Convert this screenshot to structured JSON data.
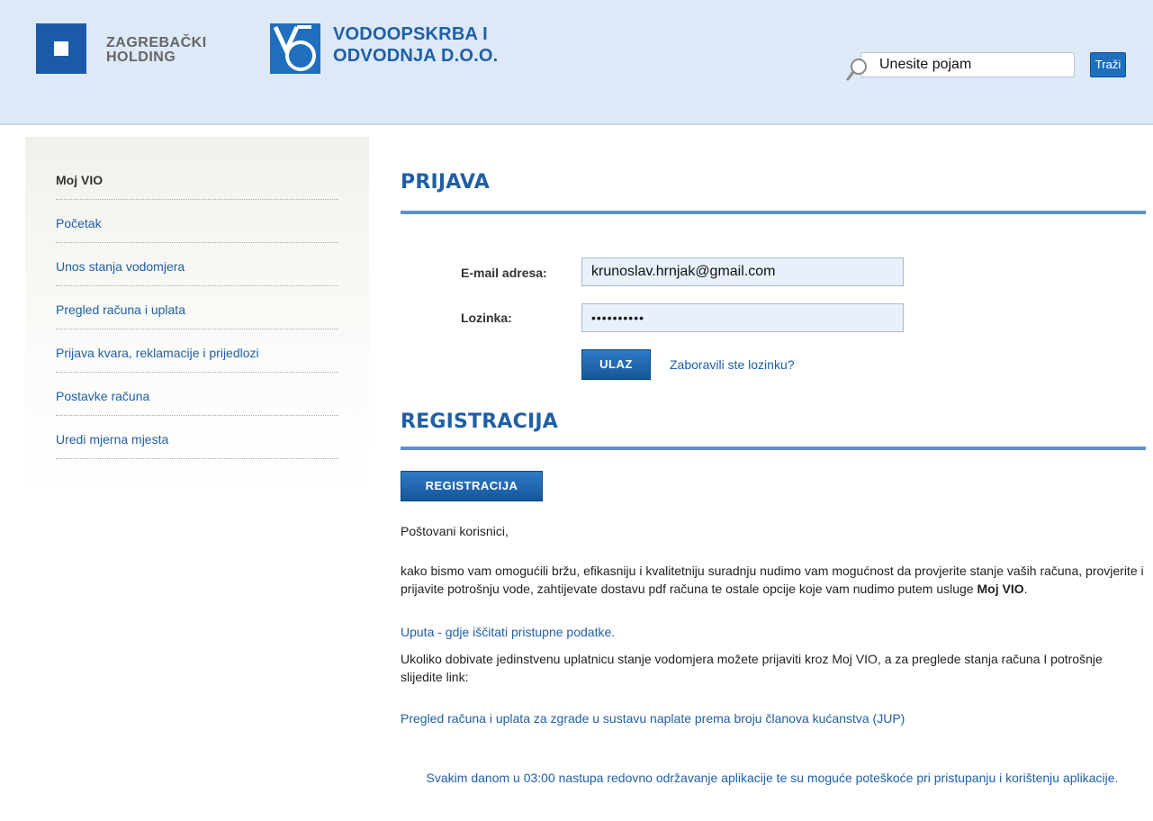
{
  "header": {
    "holding_name": "ZAGREBAČKI\nHOLDING",
    "company_line1": "VODOOPSKRBA I",
    "company_line2": "ODVODNJA D.O.O.",
    "search": {
      "placeholder": "Unesite pojam",
      "value": "Unesite pojam",
      "button_label": "Traži"
    }
  },
  "sidebar": {
    "items": [
      {
        "label": "Moj VIO"
      },
      {
        "label": "Početak"
      },
      {
        "label": "Unos stanja vodomjera"
      },
      {
        "label": "Pregled računa i uplata"
      },
      {
        "label": "Prijava kvara, reklamacije i prijedlozi"
      },
      {
        "label": "Postavke računa"
      },
      {
        "label": "Uredi mjerna mjesta"
      }
    ]
  },
  "login": {
    "title": "PRIJAVA",
    "email_label": "E-mail adresa:",
    "email_value": "krunoslav.hrnjak@gmail.com",
    "password_label": "Lozinka:",
    "password_value": "••••••••••",
    "submit_label": "ULAZ",
    "forgot_link": "Zaboravili ste lozinku?"
  },
  "registration": {
    "title": "REGISTRACIJA",
    "button_label": "REGISTRACIJA",
    "greeting": "Poštovani korisnici,",
    "body_text": "kako bismo vam omogućili bržu, efikasniju i kvalitetniju suradnju nudimo vam mogućnost da provjerite stanje vaših računa, provjerite i prijavite potrošnju vode, zahtijevate dostavu pdf računa te ostale opcije koje vam nudimo putem usluge ",
    "body_bold": "Moj VIO",
    "body_end": ".",
    "guide_link": "Uputa - gdje iščitati pristupne podatke.",
    "info_text": "Ukoliko dobivate jedinstvenu uplatnicu stanje vodomjera možete prijaviti kroz Moj VIO, a za preglede stanja računa I potrošnje slijedite link:",
    "jup_link": "Pregled računa i uplata za zgrade u sustavu naplate prema broju članova kućanstva (JUP)",
    "maintenance_notice": "Svakim danom u 03:00 nastupa redovno održavanje aplikacije te su moguće poteškoće pri pristupanju i korištenju aplikacije."
  },
  "colors": {
    "brand_blue": "#1f5fa6",
    "header_bg": "#dde9f6",
    "rule_blue": "#5f93c8"
  }
}
